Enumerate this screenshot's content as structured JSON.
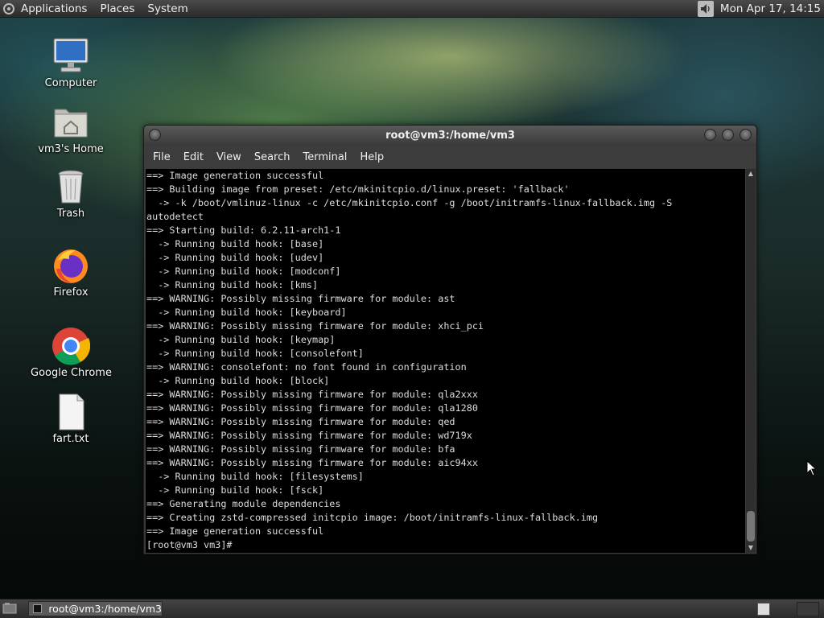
{
  "top_panel": {
    "menus": [
      "Applications",
      "Places",
      "System"
    ],
    "clock": "Mon Apr 17, 14:15"
  },
  "desktop_icons": [
    {
      "label": "Computer",
      "icon": "computer-icon"
    },
    {
      "label": "vm3's Home",
      "icon": "home-folder-icon"
    },
    {
      "label": "Trash",
      "icon": "trash-icon"
    },
    {
      "label": "Firefox",
      "icon": "firefox-icon"
    },
    {
      "label": "Google Chrome",
      "icon": "chrome-icon"
    },
    {
      "label": "fart.txt",
      "icon": "text-file-icon"
    }
  ],
  "terminal": {
    "title": "root@vm3:/home/vm3",
    "menu": [
      "File",
      "Edit",
      "View",
      "Search",
      "Terminal",
      "Help"
    ],
    "lines": [
      "==> Image generation successful",
      "==> Building image from preset: /etc/mkinitcpio.d/linux.preset: 'fallback'",
      "  -> -k /boot/vmlinuz-linux -c /etc/mkinitcpio.conf -g /boot/initramfs-linux-fallback.img -S",
      "autodetect",
      "==> Starting build: 6.2.11-arch1-1",
      "  -> Running build hook: [base]",
      "  -> Running build hook: [udev]",
      "  -> Running build hook: [modconf]",
      "  -> Running build hook: [kms]",
      "==> WARNING: Possibly missing firmware for module: ast",
      "  -> Running build hook: [keyboard]",
      "==> WARNING: Possibly missing firmware for module: xhci_pci",
      "  -> Running build hook: [keymap]",
      "  -> Running build hook: [consolefont]",
      "==> WARNING: consolefont: no font found in configuration",
      "  -> Running build hook: [block]",
      "==> WARNING: Possibly missing firmware for module: qla2xxx",
      "==> WARNING: Possibly missing firmware for module: qla1280",
      "==> WARNING: Possibly missing firmware for module: qed",
      "==> WARNING: Possibly missing firmware for module: wd719x",
      "==> WARNING: Possibly missing firmware for module: bfa",
      "==> WARNING: Possibly missing firmware for module: aic94xx",
      "  -> Running build hook: [filesystems]",
      "  -> Running build hook: [fsck]",
      "==> Generating module dependencies",
      "==> Creating zstd-compressed initcpio image: /boot/initramfs-linux-fallback.img",
      "==> Image generation successful",
      "[root@vm3 vm3]# "
    ]
  },
  "bottom_panel": {
    "task_label": "root@vm3:/home/vm3"
  }
}
